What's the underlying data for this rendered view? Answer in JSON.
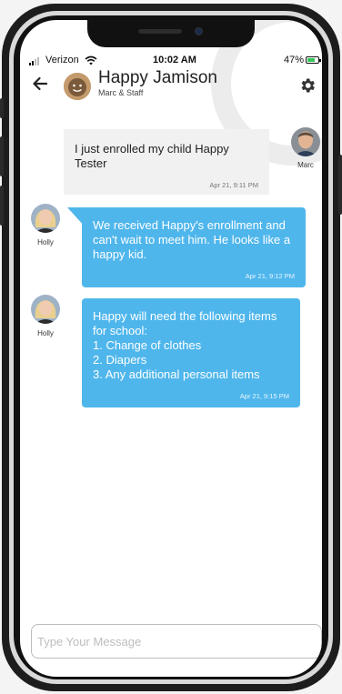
{
  "status_bar": {
    "carrier": "Verizon",
    "time": "10:02 AM",
    "battery": "47%"
  },
  "header": {
    "title": "Happy Jamison",
    "subtitle": "Marc & Staff",
    "back_icon": "back-arrow-icon",
    "settings_icon": "gear-icon"
  },
  "messages": [
    {
      "sender": "Marc",
      "direction": "outgoing",
      "text": "I just enrolled my child Happy Tester",
      "time": "Apr 21, 9:11 PM"
    },
    {
      "sender": "Holly",
      "direction": "incoming",
      "text": "We received Happy's enrollment and can't wait to meet him. He looks like a happy kid.",
      "time": "Apr 21, 9:12 PM"
    },
    {
      "sender": "Holly",
      "direction": "incoming",
      "text": "Happy will need the following items for school:\n1. Change of clothes\n2. Diapers\n3. Any additional personal items",
      "time": "Apr 21, 9:15 PM"
    }
  ],
  "compose": {
    "placeholder": "Type Your Message",
    "value": ""
  },
  "colors": {
    "incoming_bubble": "#4fb6ec",
    "outgoing_bubble": "#f1f1f1"
  }
}
